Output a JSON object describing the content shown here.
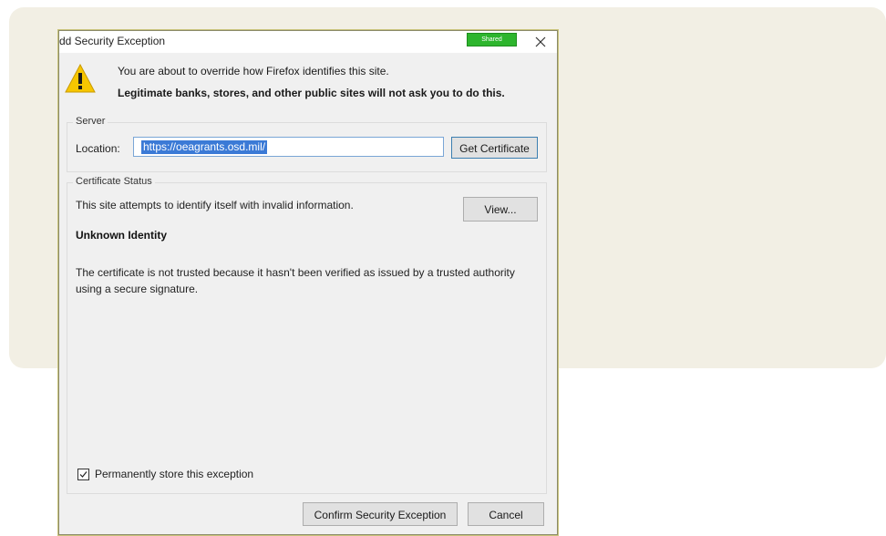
{
  "dialog": {
    "title": "dd Security Exception",
    "shared_badge": "Shared",
    "warning_line1": "You are about to override how Firefox identifies this site.",
    "warning_line2": "Legitimate banks, stores, and other public sites will not ask you to do this."
  },
  "server": {
    "legend": "Server",
    "location_label": "Location:",
    "location_value": "https://oeagrants.osd.mil/",
    "get_certificate_label": "Get Certificate"
  },
  "certificate_status": {
    "legend": "Certificate Status",
    "status_text": "This site attempts to identify itself with invalid information.",
    "view_label": "View...",
    "identity_heading": "Unknown Identity",
    "description": "The certificate is not trusted because it hasn't been verified as issued by a trusted authority using a secure signature."
  },
  "store": {
    "label": "Permanently store this exception",
    "checked": true
  },
  "buttons": {
    "confirm_label": "Confirm Security Exception",
    "cancel_label": "Cancel"
  },
  "colors": {
    "accent": "#3b7ad6",
    "shared_badge": "#2db52d",
    "warning": "#f7c600"
  }
}
